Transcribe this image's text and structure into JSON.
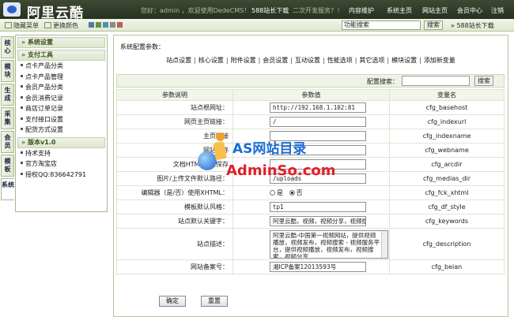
{
  "header": {
    "brand": "阿里云酷",
    "welcome": "您好：admin ，欢迎使用DedeCMS！",
    "nav": [
      "588站长下载",
      "二次开发服务？！",
      "内容维护",
      "系统主页",
      "网站主页",
      "会员中心",
      "注销"
    ]
  },
  "subbar": {
    "hide_menu": "隐藏菜单",
    "change_color": "更换颜色",
    "search_select": "功能搜索",
    "search_button": "搜索",
    "download_link": "588站长下载",
    "colors": [
      "#4a7aa8",
      "#6c8f3d",
      "#4e8fb8",
      "#8a8a8a",
      "#b65e5e"
    ]
  },
  "left_tabs": [
    "核心",
    "模块",
    "生成",
    "采集",
    "会员",
    "模板",
    "系统"
  ],
  "sidebar": {
    "sections": [
      {
        "title": "系统设置",
        "items": []
      },
      {
        "title": "支付工具",
        "items": [
          "点卡产品分类",
          "点卡产品管理",
          "会员产品分类",
          "会员消费记录",
          "商店订单记录",
          "支付接口设置",
          "配货方式设置"
        ]
      },
      {
        "title": "版本v1.0",
        "items": [
          "持术支持",
          "官方淘宝店",
          "授权QQ:836642791"
        ]
      }
    ]
  },
  "main": {
    "title": "系统配置参数：",
    "tabs": [
      "站点设置",
      "核心设置",
      "附件设置",
      "会员设置",
      "互动设置",
      "性能选项",
      "其它选项",
      "模块设置",
      "添加新变量"
    ],
    "search_label": "配置搜索：",
    "search_button": "搜索",
    "columns": [
      "参数说明",
      "参数值",
      "变量名"
    ],
    "rows": [
      {
        "label": "站点根网址：",
        "value": "http://192.168.1.102:81",
        "var": "cfg_basehost"
      },
      {
        "label": "网页主页链接：",
        "value": "/",
        "var": "cfg_indexurl"
      },
      {
        "label": "主页链接",
        "value": "",
        "var": "cfg_indexname"
      },
      {
        "label": "网站名称",
        "value": "",
        "var": "cfg_webname"
      },
      {
        "label": "文档HTML默认保存",
        "value": "",
        "var": "cfg_arcdir"
      },
      {
        "label": "图片/上传文件默认路径：",
        "value": "/uploads",
        "var": "cfg_medias_dir"
      },
      {
        "label": "编辑器（是/否）使用XHTML：",
        "radio_yes": "是",
        "radio_no": "否",
        "var": "cfg_fck_xhtml"
      },
      {
        "label": "模板默认风格：",
        "value": "tp1",
        "var": "cfg_df_style"
      },
      {
        "label": "站点默认关键字：",
        "value": "阿里云酷，视频，视频分享，视频搜索",
        "var": "cfg_keywords"
      },
      {
        "label": "站点描述：",
        "value": "阿里云酷-中国第一视频网站，提供视频播放，视频发布，视频搜索 - 视频服务平台，提供视频播放，视频发布，视频搜索，视频分享",
        "var": "cfg_description"
      },
      {
        "label": "网站备案号：",
        "value": "湘ICP备案12013593号",
        "var": "cfg_beian"
      }
    ],
    "confirm_button": "确定",
    "reset_button": "重置"
  },
  "watermark": {
    "title": "AS网站目录",
    "url": "AdminSo.com"
  }
}
